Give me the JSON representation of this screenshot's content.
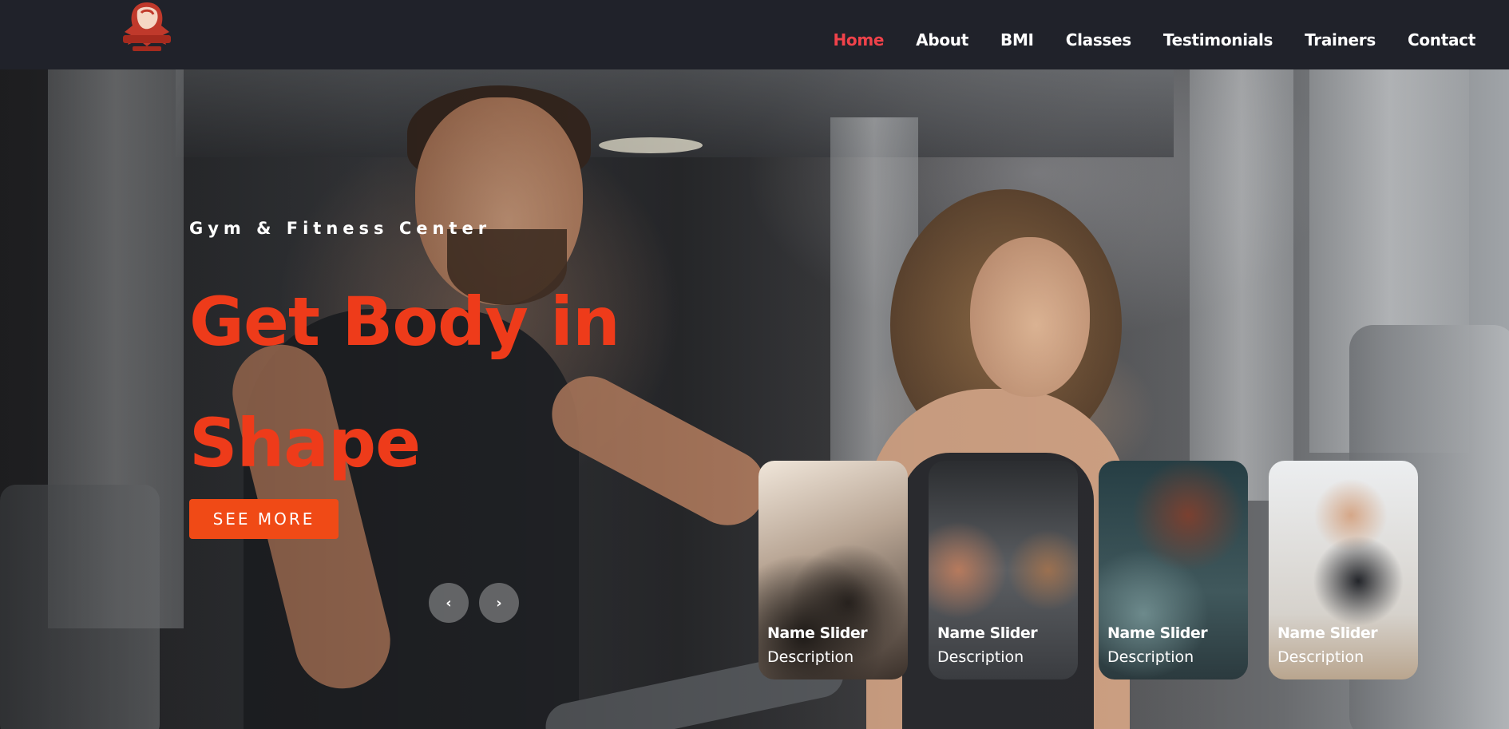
{
  "header": {
    "logo_icon": "muscle-arm-fitness-logo-icon",
    "nav": [
      {
        "label": "Home",
        "active": true
      },
      {
        "label": "About",
        "active": false
      },
      {
        "label": "BMI",
        "active": false
      },
      {
        "label": "Classes",
        "active": false
      },
      {
        "label": "Testimonials",
        "active": false
      },
      {
        "label": "Trainers",
        "active": false
      },
      {
        "label": "Contact",
        "active": false
      }
    ]
  },
  "hero": {
    "subtitle": "Gym & Fitness Center",
    "title_line1": "Get Body in",
    "title_line2": "Shape",
    "cta_label": "SEE MORE",
    "prev_icon": "chevron-left-icon",
    "next_icon": "chevron-right-icon",
    "prev_glyph": "‹",
    "next_glyph": "›"
  },
  "slider": {
    "items": [
      {
        "name": "Name Slider",
        "description": "Description"
      },
      {
        "name": "Name Slider",
        "description": "Description"
      },
      {
        "name": "Name Slider",
        "description": "Description"
      },
      {
        "name": "Name Slider",
        "description": "Description"
      }
    ]
  },
  "colors": {
    "accent": "#f0424a",
    "title": "#ee3b1a",
    "button": "#f04a16",
    "header_bg": "#20222a"
  }
}
